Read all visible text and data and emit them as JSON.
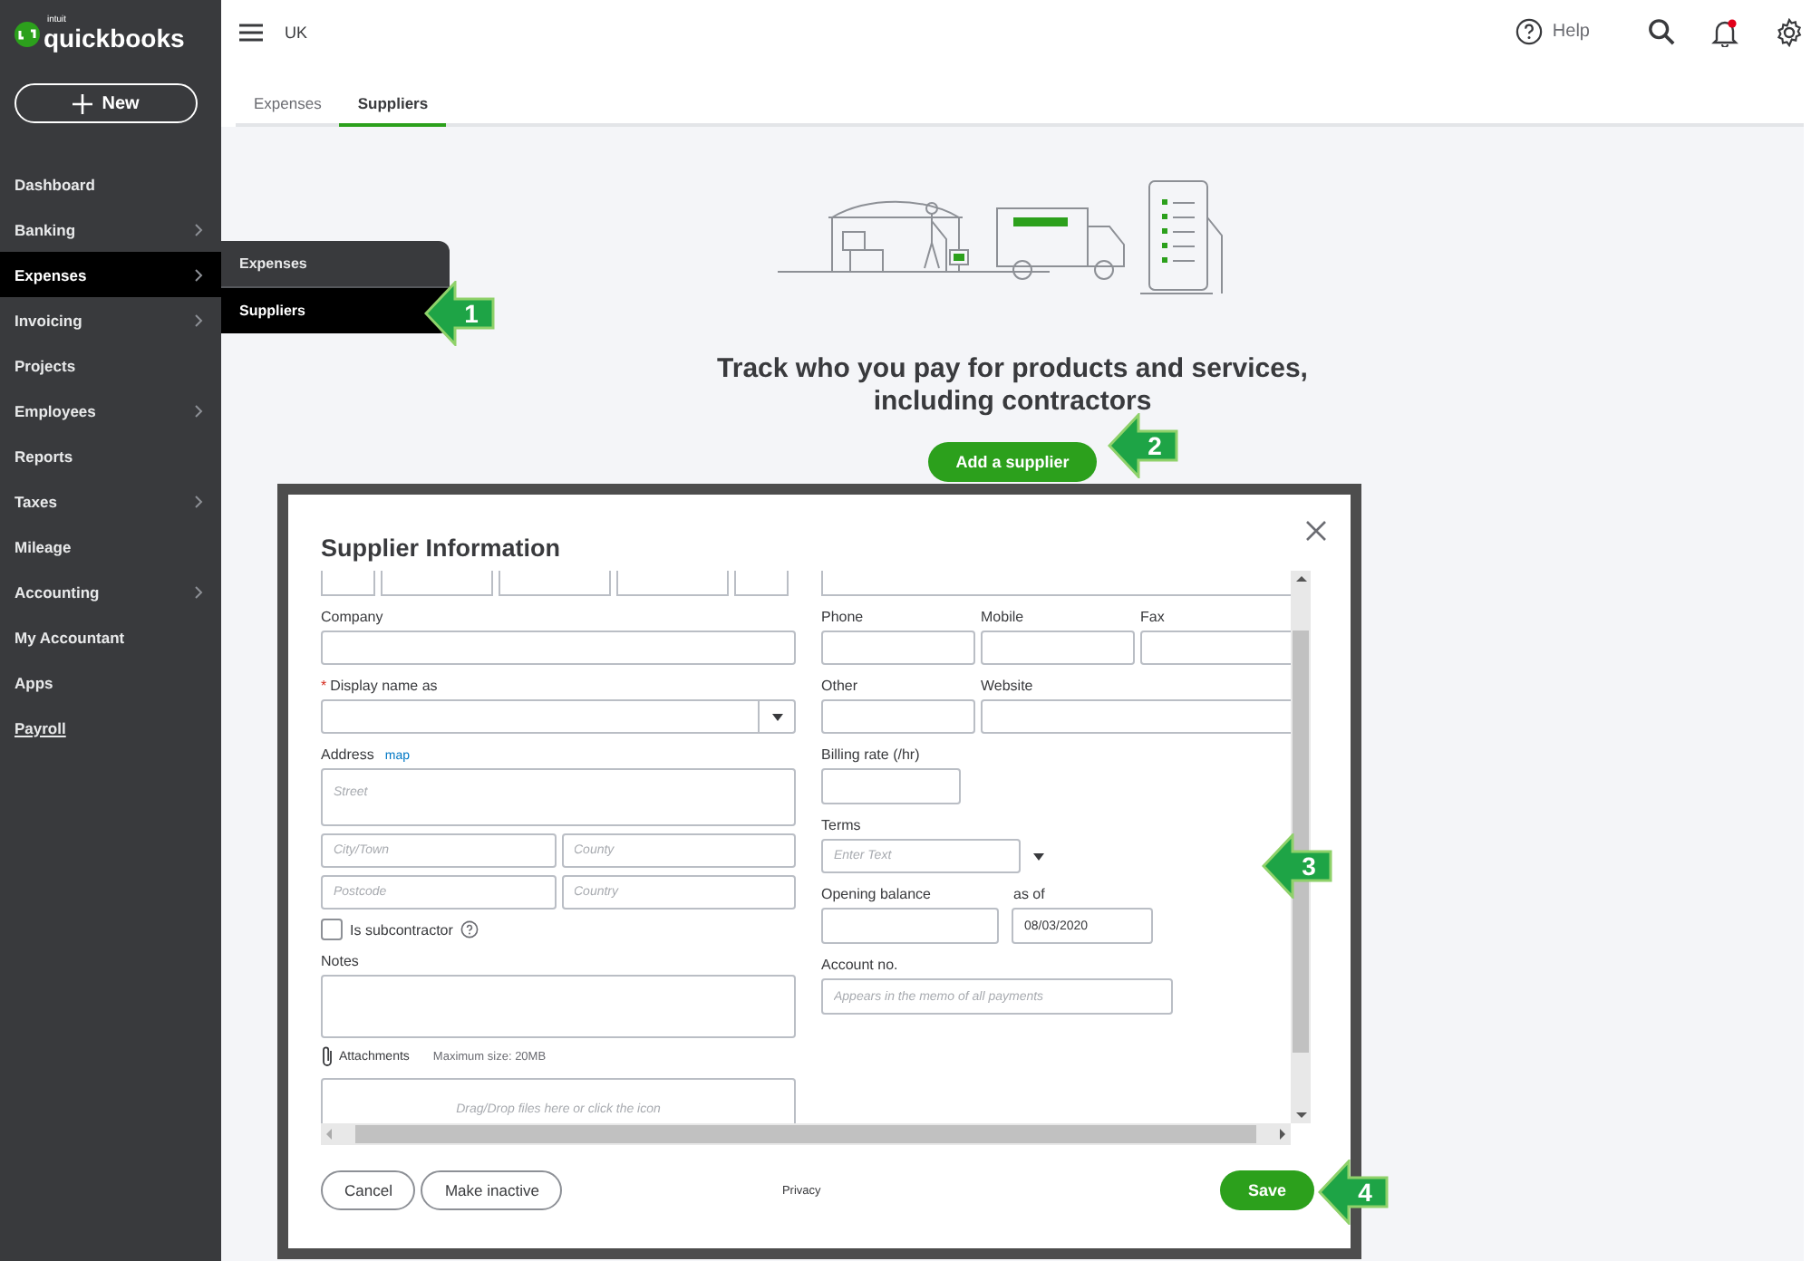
{
  "brand": {
    "prefix": "intuit",
    "name": "quickbooks"
  },
  "new_button": {
    "label": "New"
  },
  "sidebar": {
    "items": [
      {
        "label": "Dashboard",
        "selected": false,
        "has_submenu": false,
        "underlined": false
      },
      {
        "label": "Banking",
        "selected": false,
        "has_submenu": true,
        "underlined": false
      },
      {
        "label": "Expenses",
        "selected": true,
        "has_submenu": true,
        "underlined": false
      },
      {
        "label": "Invoicing",
        "selected": false,
        "has_submenu": true,
        "underlined": false
      },
      {
        "label": "Projects",
        "selected": false,
        "has_submenu": false,
        "underlined": false
      },
      {
        "label": "Employees",
        "selected": false,
        "has_submenu": true,
        "underlined": false
      },
      {
        "label": "Reports",
        "selected": false,
        "has_submenu": false,
        "underlined": false
      },
      {
        "label": "Taxes",
        "selected": false,
        "has_submenu": true,
        "underlined": false
      },
      {
        "label": "Mileage",
        "selected": false,
        "has_submenu": false,
        "underlined": false
      },
      {
        "label": "Accounting",
        "selected": false,
        "has_submenu": true,
        "underlined": false
      },
      {
        "label": "My Accountant",
        "selected": false,
        "has_submenu": false,
        "underlined": false
      },
      {
        "label": "Apps",
        "selected": false,
        "has_submenu": false,
        "underlined": false
      },
      {
        "label": "Payroll",
        "selected": false,
        "has_submenu": false,
        "underlined": true
      }
    ]
  },
  "flyout": {
    "items": [
      {
        "label": "Expenses",
        "selected": false
      },
      {
        "label": "Suppliers",
        "selected": true
      }
    ]
  },
  "topbar": {
    "company": "UK",
    "help": "Help"
  },
  "tabs": [
    {
      "label": "Expenses",
      "selected": false
    },
    {
      "label": "Suppliers",
      "selected": true
    }
  ],
  "empty_state": {
    "heading": "Track who you pay for products and services, including contractors",
    "button": "Add a supplier"
  },
  "dialog": {
    "title": "Supplier Information",
    "company": {
      "label": "Company"
    },
    "display_name": {
      "label": "Display name as",
      "required_mark": "*"
    },
    "address": {
      "label": "Address",
      "link": "map",
      "street": {
        "placeholder": "Street"
      },
      "city": {
        "placeholder": "City/Town"
      },
      "county": {
        "placeholder": "County"
      },
      "postcode": {
        "placeholder": "Postcode"
      },
      "country": {
        "placeholder": "Country"
      }
    },
    "subcontractor": {
      "label": "Is subcontractor",
      "checked": false
    },
    "notes": {
      "label": "Notes"
    },
    "attachments": {
      "label": "Attachments",
      "limit": "Maximum size: 20MB",
      "dropzone": "Drag/Drop files here or click the icon"
    },
    "phone": {
      "label": "Phone"
    },
    "mobile": {
      "label": "Mobile"
    },
    "fax": {
      "label": "Fax"
    },
    "other": {
      "label": "Other"
    },
    "website": {
      "label": "Website"
    },
    "billing_rate": {
      "label": "Billing rate (/hr)"
    },
    "terms": {
      "label": "Terms",
      "placeholder": "Enter Text"
    },
    "opening_balance": {
      "label": "Opening balance"
    },
    "as_of": {
      "label": "as of",
      "value": "08/03/2020"
    },
    "account_no": {
      "label": "Account no.",
      "placeholder": "Appears in the memo of all payments"
    },
    "buttons": {
      "cancel": "Cancel",
      "make_inactive": "Make inactive",
      "privacy": "Privacy",
      "save": "Save"
    }
  },
  "callouts": [
    "1",
    "2",
    "3",
    "4"
  ]
}
